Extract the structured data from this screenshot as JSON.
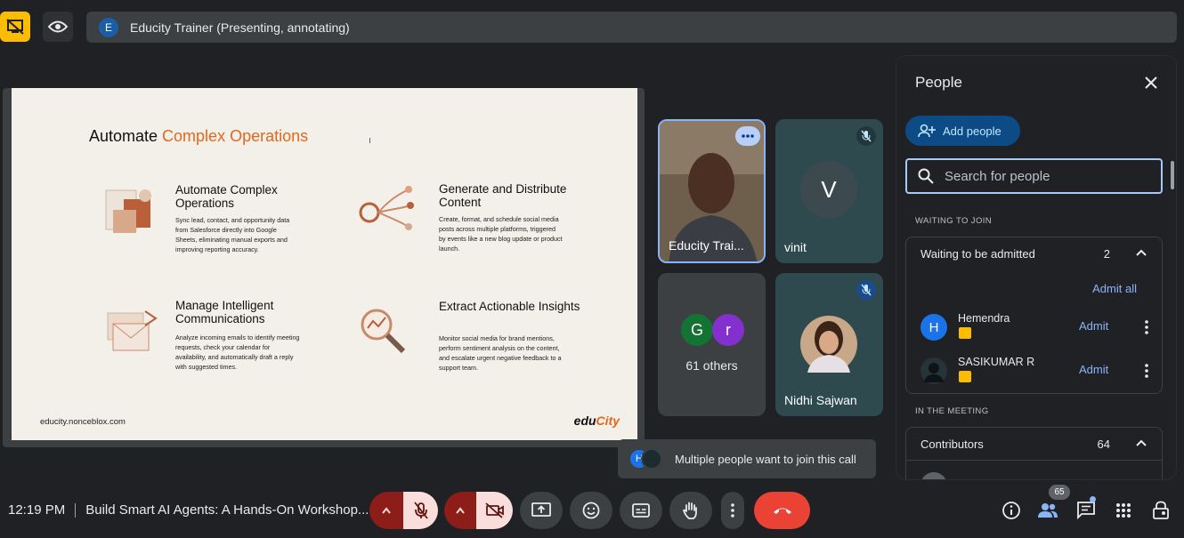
{
  "presenter_bar": {
    "avatar_letter": "E",
    "text": "Educity Trainer (Presenting, annotating)"
  },
  "slide": {
    "title_plain": "Automate ",
    "title_accent": "Complex Operations",
    "cards": [
      {
        "head": "Automate Complex Operations",
        "body": "Sync lead, contact, and opportunity data from Salesforce directly into Google Sheets, eliminating manual exports and improving reporting accuracy."
      },
      {
        "head": "Generate and Distribute Content",
        "body": "Create, format, and schedule social media posts across multiple platforms, triggered by events like a new blog update or product launch."
      },
      {
        "head": "Manage Intelligent Communications",
        "body": "Analyze incoming emails to identify meeting requests, check your calendar for availability, and automatically draft a reply with suggested times."
      },
      {
        "head": "Extract Actionable Insights",
        "body": "Monitor social media for brand mentions, perform sentiment analysis on the content, and escalate urgent negative feedback to a support team."
      }
    ],
    "footer_url": "educity.nonceblox.com",
    "logo_pre": "edu",
    "logo_post": "City"
  },
  "tiles": {
    "trainer_name": "Educity Trai...",
    "vinit_name": "vinit",
    "vinit_letter": "V",
    "others_letters": [
      "G",
      "r"
    ],
    "others_label": "61 others",
    "nidhi_name": "Nidhi Sajwan"
  },
  "panel": {
    "title": "People",
    "add_people": "Add people",
    "search_placeholder": "Search for people",
    "waiting_section": "WAITING TO JOIN",
    "waiting_group": "Waiting to be admitted",
    "waiting_count": "2",
    "admit_all": "Admit all",
    "waiting": [
      {
        "name": "Hemendra",
        "letter": "H",
        "action": "Admit"
      },
      {
        "name": "SASIKUMAR R",
        "letter": "",
        "action": "Admit"
      }
    ],
    "meeting_section": "IN THE MEETING",
    "contributors_group": "Contributors",
    "contributors_count": "64"
  },
  "toast": {
    "avatar_letter": "H",
    "text": "Multiple people want to join this call"
  },
  "bottom": {
    "time": "12:19 PM",
    "meeting_title": "Build Smart AI Agents: A Hands-On Workshop...",
    "people_count": "65"
  },
  "colors": {
    "accent_orange": "#e0691c",
    "present_yellow": "#fbbc04",
    "hangup_red": "#ea4335",
    "link_blue": "#8ab4f8"
  }
}
